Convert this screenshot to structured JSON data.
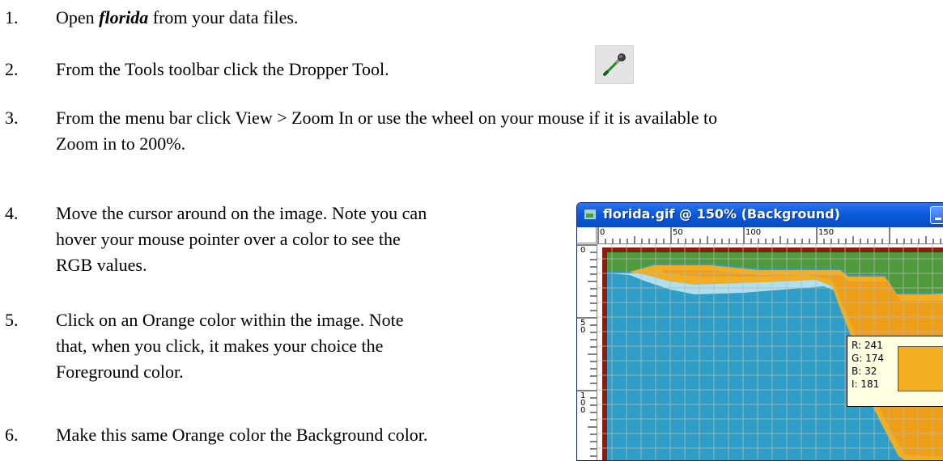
{
  "steps": [
    {
      "num": "1.",
      "pre": "Open ",
      "emph": "florida",
      "post": " from your data files."
    },
    {
      "num": "2.",
      "text": "From the Tools toolbar click the Dropper Tool."
    },
    {
      "num": "3.",
      "line1": "From the menu bar click View > Zoom In or use the wheel on your mouse if it is available to",
      "line2": "Zoom in to 200%."
    },
    {
      "num": "4.",
      "line1": "Move the cursor around on the image. Note you can",
      "line2": "hover your mouse pointer over a color to see the",
      "line3": "RGB values."
    },
    {
      "num": "5.",
      "line1": "Click on an Orange color within the image. Note",
      "line2": "that, when you click, it makes your choice the",
      "line3": "Foreground color."
    },
    {
      "num": "6.",
      "text": "Make this same Orange color the Background color."
    }
  ],
  "tool_icon": "dropper-icon",
  "window": {
    "title": "florida.gif @ 150% (Background)",
    "ruler_top": [
      "0",
      "50",
      "100",
      "150"
    ],
    "ruler_left": [
      "0",
      "5\n0",
      "1\n0\n0"
    ]
  },
  "readout": {
    "r": "R: 241",
    "g": "G: 174",
    "b": "B: 32",
    "i": "I: 181",
    "swatch_color": "#f1ae20"
  },
  "colors": {
    "water": "#2e9ec6",
    "coast": "#aee0f0",
    "land_orange": "#f1ae20",
    "land_green": "#4f9a3a",
    "border": "#8b1a10",
    "grid": "#b9b9b9"
  }
}
